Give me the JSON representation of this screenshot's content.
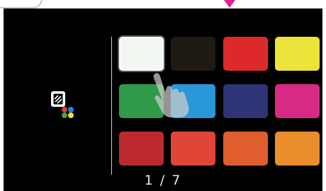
{
  "pager": {
    "text": "1 / 7"
  },
  "palette": {
    "icon": "palette-icon",
    "selected_index": 0,
    "swatches": [
      {
        "name": "white",
        "color": "#f2f7f2"
      },
      {
        "name": "dark-brown",
        "color": "#1f1a12"
      },
      {
        "name": "red",
        "color": "#dc2a2b"
      },
      {
        "name": "yellow",
        "color": "#ebe33a"
      },
      {
        "name": "green",
        "color": "#2f9a4a"
      },
      {
        "name": "blue",
        "color": "#2a97d8"
      },
      {
        "name": "navy",
        "color": "#2f3474"
      },
      {
        "name": "magenta",
        "color": "#d72a84"
      },
      {
        "name": "crimson",
        "color": "#bc2a30"
      },
      {
        "name": "tomato",
        "color": "#df4638"
      },
      {
        "name": "orange-red",
        "color": "#e05e2d"
      },
      {
        "name": "orange",
        "color": "#ea8d2c"
      }
    ]
  },
  "colors": {
    "accent_pointer": "#e2218c",
    "screen_background": "#000000"
  }
}
